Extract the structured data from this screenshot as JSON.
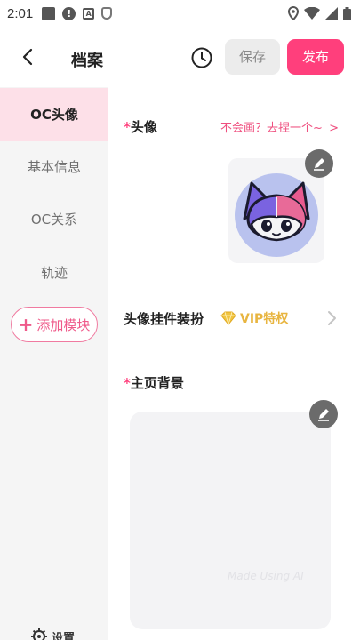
{
  "status_bar": {
    "time": "2:01"
  },
  "header": {
    "title": "档案",
    "save_label": "保存",
    "publish_label": "发布"
  },
  "sidebar": {
    "items": [
      {
        "label": "OC头像"
      },
      {
        "label": "基本信息"
      },
      {
        "label": "OC关系"
      },
      {
        "label": "轨迹"
      }
    ],
    "add_module_label": "添加模块",
    "settings_label": "设置"
  },
  "main": {
    "avatar": {
      "required_mark": "*",
      "label": "头像",
      "helper_link": "不会画？去捏一个~"
    },
    "decoration": {
      "label": "头像挂件装扮",
      "vip_label": "VIP特权"
    },
    "background": {
      "required_mark": "*",
      "label": "主页背景",
      "watermark": "Made Using AI"
    }
  },
  "colors": {
    "accent": "#ff3f7c",
    "sidebar_active_bg": "#fde0e8",
    "vip_gold": "#e8b540"
  }
}
